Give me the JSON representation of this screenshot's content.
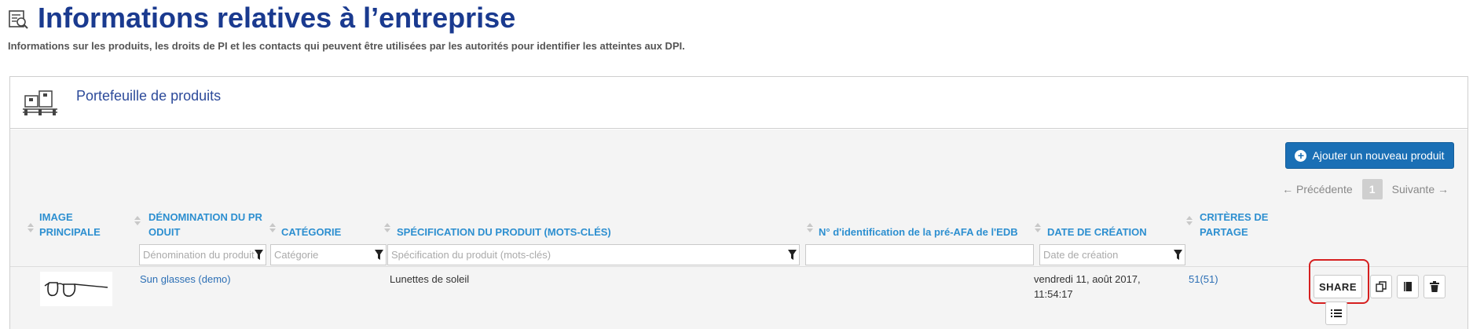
{
  "header": {
    "title": "Informations relatives à l’entreprise",
    "subtitle": "Informations sur les produits, les droits de PI et les contacts qui peuvent être utilisées par les autorités pour identifier les atteintes aux DPI."
  },
  "panel": {
    "title": "Portefeuille de produits",
    "add_button": "Ajouter un nouveau produit"
  },
  "pager": {
    "prev": "← Précédente",
    "current": "1",
    "next": "Suivante →"
  },
  "columns": [
    {
      "l1": "IMAGE",
      "l2": "PRINCIPALE"
    },
    {
      "l1": "DÉNOMINATION DU PR",
      "l2": "ODUIT"
    },
    {
      "l1": "CATÉGORIE",
      "l2": ""
    },
    {
      "l1": "SPÉCIFICATION DU PRODUIT (MOTS-CLÉS)",
      "l2": ""
    },
    {
      "l1": "N° d'identification de la pré-AFA de l'EDB",
      "l2": ""
    },
    {
      "l1": "DATE DE CRÉATION",
      "l2": ""
    },
    {
      "l1": "CRITÈRES DE",
      "l2": "PARTAGE"
    }
  ],
  "filters": {
    "name": "Dénomination du produit",
    "category": "Catégorie",
    "spec": "Spécification du produit (mots-clés)",
    "afa": "",
    "date": "Date de création"
  },
  "rows": [
    {
      "name": "Sun glasses (demo)",
      "spec": "Lunettes de soleil",
      "date_line1": "vendredi 11, août 2017,",
      "date_line2": "11:54:17",
      "sharing": "51(51)",
      "share_label": "SHARE"
    }
  ],
  "colors": {
    "title": "#1a3a8f",
    "header_link": "#2d8fd0",
    "primary_button": "#1a6fb5",
    "highlight": "#d62020"
  },
  "icons": [
    "report-icon",
    "product-boxes-icon",
    "plus-circle-icon",
    "sort-icon",
    "filter-icon",
    "copy-icon",
    "notebook-icon",
    "trash-icon",
    "list-icon",
    "glasses-image"
  ]
}
